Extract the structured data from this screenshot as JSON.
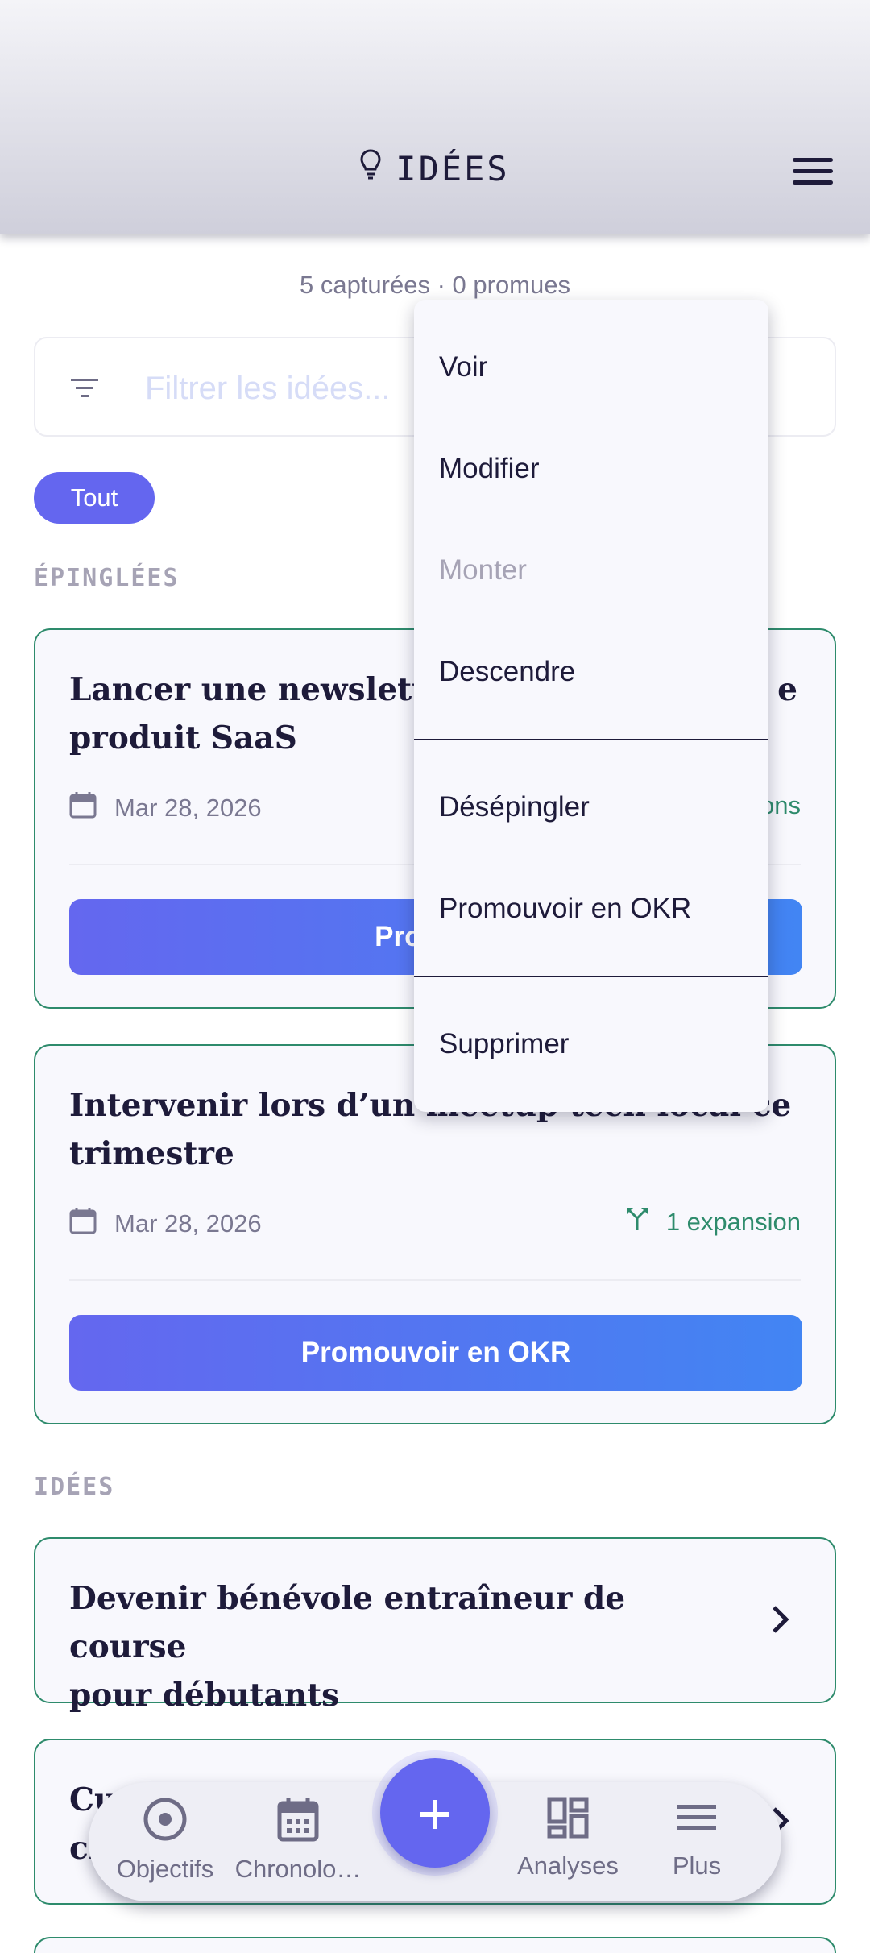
{
  "header": {
    "title": "IDÉES"
  },
  "summary": "5 capturées · 0 promues",
  "filter": {
    "placeholder": "Filtrer les idées..."
  },
  "chips": [
    {
      "label": "Tout",
      "active": true
    }
  ],
  "sections": {
    "pinned_label": "ÉPINGLÉES",
    "ideas_label": "IDÉES"
  },
  "pinned_cards": [
    {
      "title_line1": "Lancer une newsletter",
      "title_line1_tail": "e",
      "title_line2": "produit SaaS",
      "date": "Mar 28, 2026",
      "expansions": "ons",
      "promote_label": "Promouv"
    },
    {
      "title_line1": "Intervenir lors d’un meetup tech local ce",
      "title_line2": "trimestre",
      "date": "Mar 28, 2026",
      "expansions": "1 expansion",
      "promote_label": "Promouvoir en OKR"
    }
  ],
  "idea_cards": [
    {
      "title_line1": "Devenir bénévole entraîneur de course",
      "title_line2": "pour débutants"
    },
    {
      "title_line1": "Cu",
      "title_line2": "cl"
    }
  ],
  "context_menu": {
    "items": [
      {
        "label": "Voir",
        "disabled": false
      },
      {
        "label": "Modifier",
        "disabled": false
      },
      {
        "label": "Monter",
        "disabled": true
      },
      {
        "label": "Descendre",
        "disabled": false
      },
      {
        "label": "Désépingler",
        "disabled": false
      },
      {
        "label": "Promouvoir en OKR",
        "disabled": false
      },
      {
        "label": "Supprimer",
        "disabled": false
      }
    ]
  },
  "bottom_nav": {
    "items": [
      {
        "label": "Objectifs",
        "icon": "target-icon"
      },
      {
        "label": "Chronolo…",
        "icon": "calendar-icon"
      },
      {
        "label": "Analyses",
        "icon": "dashboard-icon"
      },
      {
        "label": "Plus",
        "icon": "menu-icon"
      }
    ],
    "fab_icon": "plus-icon"
  },
  "colors": {
    "accent": "#6466ef",
    "accent_blue": "#4285f3",
    "card_border": "#2e8b6c",
    "text_dark": "#1e1b3a",
    "text_muted": "#7a7891"
  }
}
